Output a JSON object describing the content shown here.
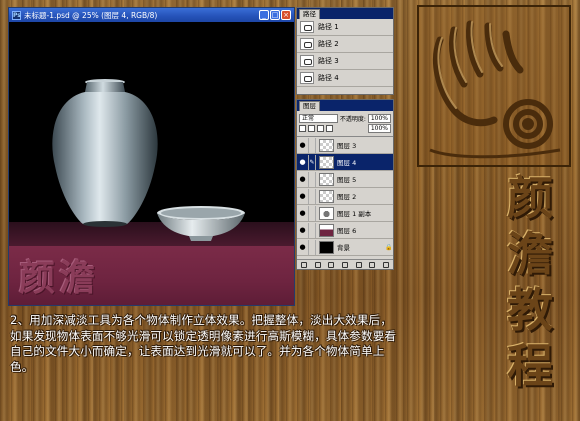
{
  "document": {
    "title": "未标题-1.psd @ 25% (图层 4, RGB/8)",
    "buttons": [
      "_",
      "□",
      "×"
    ],
    "table_logo": "颜澹"
  },
  "paths_panel": {
    "tab": "路径",
    "paths": [
      "路径 1",
      "路径 2",
      "路径 3",
      "路径 4"
    ]
  },
  "layers_panel": {
    "tab": "图层",
    "blend_mode": "正常",
    "opacity_label": "不透明度:",
    "opacity_value": "100%",
    "fill_value": "100%",
    "layers": [
      {
        "name": "图层 3",
        "visible": true,
        "active": false
      },
      {
        "name": "图层 4",
        "visible": true,
        "active": true
      },
      {
        "name": "图层 5",
        "visible": true,
        "active": false
      },
      {
        "name": "图层 2",
        "visible": true,
        "active": false
      },
      {
        "name": "图层 1 副本",
        "visible": true,
        "active": false
      },
      {
        "name": "图层 6",
        "visible": true,
        "active": false
      },
      {
        "name": "背景",
        "visible": true,
        "active": false
      }
    ]
  },
  "caption": "2、用加深减淡工具为各个物体制作立体效果。把握整体，淡出大效果后，如果发现物体表面不够光滑可以锁定透明像素进行高斯模糊，具体参数要看自己的文件大小而确定，让表面达到光滑就可以了。并为各个物体简单上色。",
  "side_title": [
    "颜",
    "澹",
    "教",
    "程"
  ],
  "colors": {
    "titlebar": "#2552b8",
    "active_layer": "#0a246a",
    "table_cloth": "#6e2440",
    "wood": "#9a6a2e"
  }
}
